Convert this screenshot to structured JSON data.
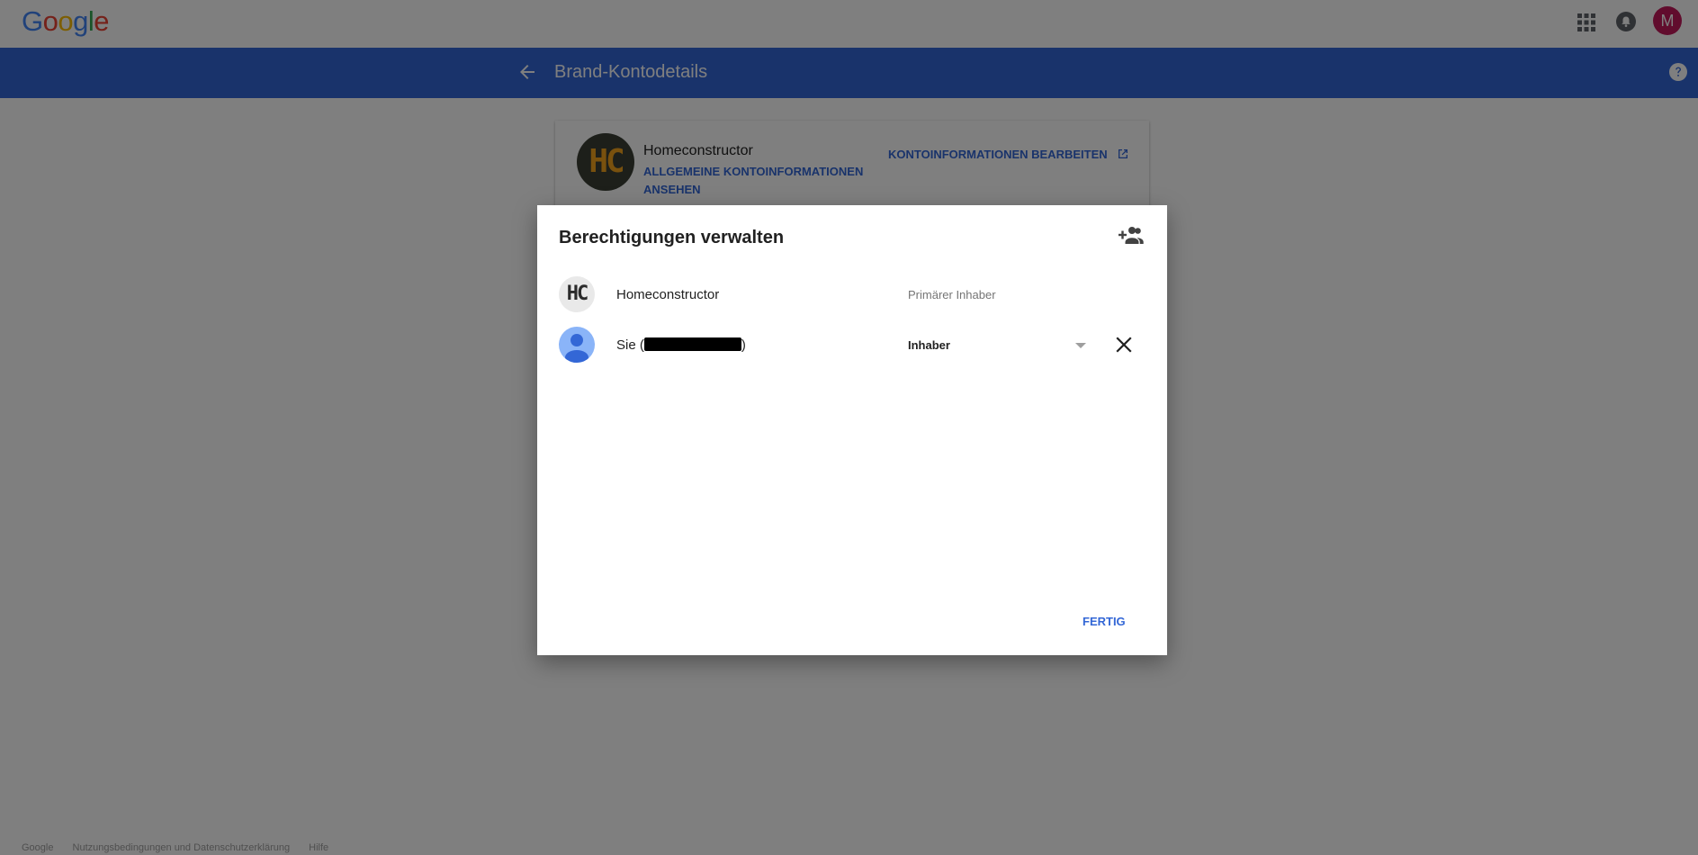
{
  "colors": {
    "brand_blue": "#3367d6",
    "link_blue": "#3367d6",
    "avatar_bg": "#c2185b",
    "icon_gray": "#5f6368"
  },
  "header": {
    "logo_letters": [
      {
        "ch": "G",
        "color": "#4285f4"
      },
      {
        "ch": "o",
        "color": "#ea4335"
      },
      {
        "ch": "o",
        "color": "#fbbc05"
      },
      {
        "ch": "g",
        "color": "#4285f4"
      },
      {
        "ch": "l",
        "color": "#34a853"
      },
      {
        "ch": "e",
        "color": "#ea4335"
      }
    ],
    "apps_icon": "apps-grid-icon",
    "notifications_icon": "bell-icon",
    "avatar_initial": "M"
  },
  "title_bar": {
    "back_icon": "arrow-back-icon",
    "title": "Brand-Kontodetails",
    "help_icon": "help-icon"
  },
  "brand_card": {
    "logo_text": "HC",
    "name": "Homeconstructor",
    "view_info_link": "ALLGEMEINE KONTOINFORMATIONEN ANSEHEN",
    "edit_info_link": "KONTOINFORMATIONEN BEARBEITEN",
    "edit_info_icon": "open-in-new-icon"
  },
  "dialog": {
    "title": "Berechtigungen verwalten",
    "add_user_icon": "person-add-icon",
    "rows": [
      {
        "logo_text": "HC",
        "name": "Homeconstructor",
        "role": "Primärer Inhaber"
      },
      {
        "name_prefix": "Sie (",
        "name_suffix": ")",
        "role": "Inhaber"
      }
    ],
    "done_label": "FERTIG"
  },
  "footer": {
    "items": [
      "Google",
      "Nutzungsbedingungen und Datenschutzerklärung",
      "Hilfe"
    ]
  }
}
